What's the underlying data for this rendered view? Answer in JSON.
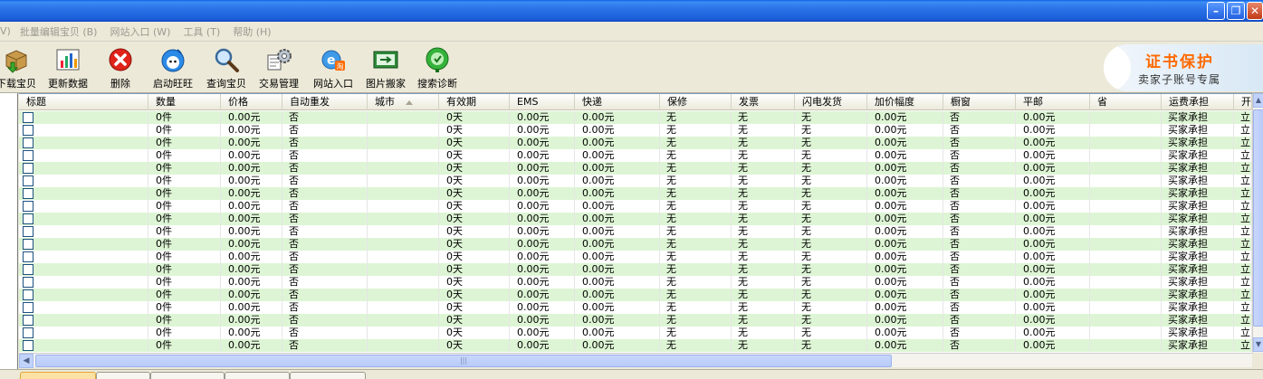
{
  "window": {
    "controls": {
      "minimize": "–",
      "restore": "❐",
      "close": "✕"
    }
  },
  "menu": [
    "批量编辑宝贝 (B)",
    "网站入口 (W)",
    "工具 (T)",
    "帮助 (H)"
  ],
  "menu_prefix": "V)",
  "toolbar": [
    {
      "label": "下载宝贝",
      "icon": "download-box-icon"
    },
    {
      "label": "更新数据",
      "icon": "chart-icon"
    },
    {
      "label": "删除",
      "icon": "delete-icon"
    },
    {
      "label": "启动旺旺",
      "icon": "wangwang-icon"
    },
    {
      "label": "查询宝贝",
      "icon": "magnifier-icon"
    },
    {
      "label": "交易管理",
      "icon": "gear-icon"
    },
    {
      "label": "网站入口",
      "icon": "ie-icon"
    },
    {
      "label": "图片搬家",
      "icon": "image-move-icon"
    },
    {
      "label": "搜索诊断",
      "icon": "search-diagnose-icon"
    }
  ],
  "banner": {
    "line1": "证书保护",
    "line2": "卖家子账号专属"
  },
  "grid": {
    "columns": [
      "标题",
      "数量",
      "价格",
      "自动重发",
      "城市",
      "有效期",
      "EMS",
      "快递",
      "保修",
      "发票",
      "闪电发货",
      "加价幅度",
      "橱窗",
      "平邮",
      "省",
      "运费承担",
      "开"
    ],
    "row_template": [
      "",
      "0件",
      "0.00元",
      "否",
      "",
      "0天",
      "0.00元",
      "0.00元",
      "无",
      "无",
      "无",
      "0.00元",
      "否",
      "0.00元",
      "",
      "买家承担",
      "立"
    ],
    "row_count": 19
  },
  "scrollbar": {
    "grip": "|||"
  },
  "colors": {
    "title": "#2a72e8",
    "alt_row": "#ddf5d4",
    "banner_accent": "#ff6a00"
  }
}
